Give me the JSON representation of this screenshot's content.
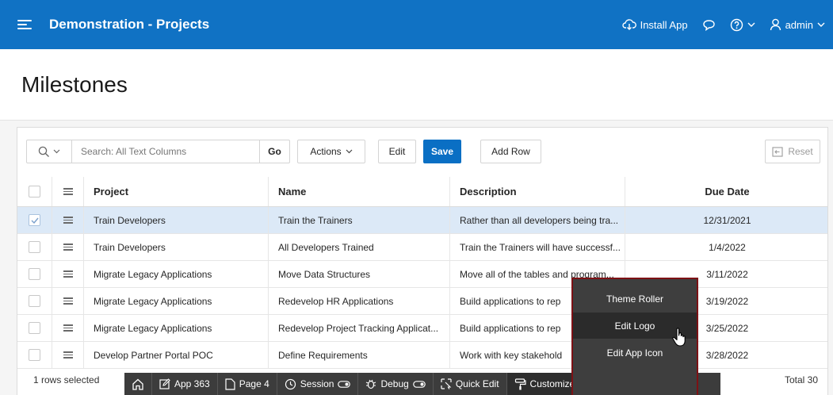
{
  "header": {
    "app_title": "Demonstration - Projects",
    "install_app": "Install App",
    "user": "admin"
  },
  "page": {
    "title": "Milestones"
  },
  "toolbar": {
    "search_placeholder": "Search: All Text Columns",
    "go": "Go",
    "actions": "Actions",
    "edit": "Edit",
    "save": "Save",
    "add_row": "Add Row",
    "reset": "Reset"
  },
  "grid": {
    "columns": [
      "Project",
      "Name",
      "Description",
      "Due Date"
    ],
    "rows": [
      {
        "project": "Train Developers",
        "name": "Train the Trainers",
        "description": "Rather than all developers being tra...",
        "due": "12/31/2021",
        "selected": true
      },
      {
        "project": "Train Developers",
        "name": "All Developers Trained",
        "description": "Train the Trainers will have successf...",
        "due": "1/4/2022",
        "selected": false
      },
      {
        "project": "Migrate Legacy Applications",
        "name": "Move Data Structures",
        "description": "Move all of the tables and program...",
        "due": "3/11/2022",
        "selected": false
      },
      {
        "project": "Migrate Legacy Applications",
        "name": "Redevelop HR Applications",
        "description": "Build applications to rep",
        "due": "3/19/2022",
        "selected": false
      },
      {
        "project": "Migrate Legacy Applications",
        "name": "Redevelop Project Tracking Applicat...",
        "description": "Build applications to rep",
        "due": "3/25/2022",
        "selected": false
      },
      {
        "project": "Develop Partner Portal POC",
        "name": "Define Requirements",
        "description": "Work with key stakehold",
        "due": "3/28/2022",
        "selected": false
      }
    ]
  },
  "footer": {
    "selected_text": "1 rows selected",
    "total_text": "Total 30"
  },
  "devbar": {
    "app": "App 363",
    "page": "Page 4",
    "session": "Session",
    "debug": "Debug",
    "quick_edit": "Quick Edit",
    "customize": "Customize"
  },
  "customize_menu": {
    "items": [
      "Theme Roller",
      "Edit Logo",
      "Edit App Icon"
    ]
  },
  "colors": {
    "header_bg": "#1072c4",
    "save_bg": "#0a6fc4",
    "selected_row": "#dce9f7",
    "devbar_bg": "#3c3c3c",
    "popup_border": "#7d1115"
  }
}
